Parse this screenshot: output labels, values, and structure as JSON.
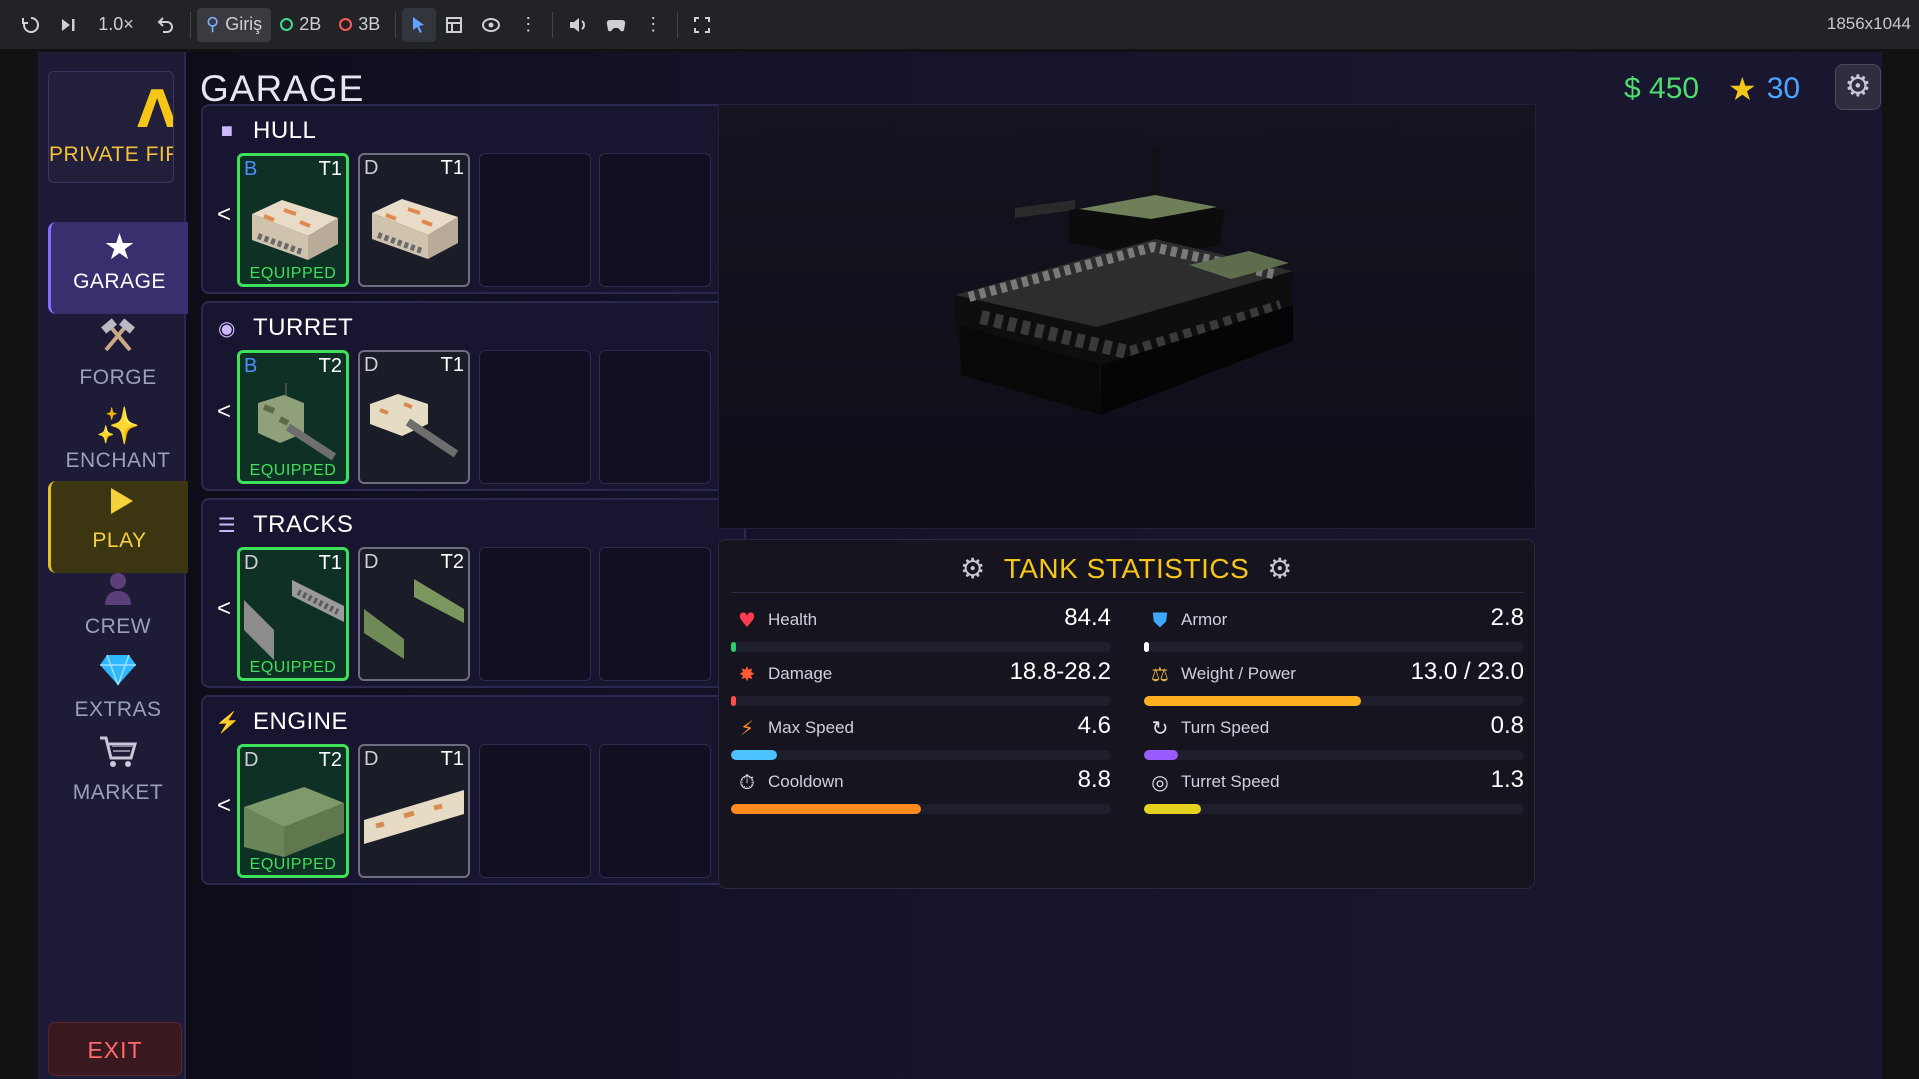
{
  "toolbar": {
    "speed": "1.0×",
    "scene_tab": "Giriş",
    "mode_2d": "2B",
    "mode_3d": "3B",
    "resolution": "1856x1044"
  },
  "header": {
    "title": "GARAGE",
    "money": "$ 450",
    "stars": "30"
  },
  "rank": {
    "logo": "Λ.",
    "name": "PRIVATE FIRST"
  },
  "nav": [
    {
      "label": "GARAGE",
      "icon": "star-icon"
    },
    {
      "label": "FORGE",
      "icon": "hammers-icon"
    },
    {
      "label": "ENCHANT",
      "icon": "sparkles-icon"
    },
    {
      "label": "PLAY",
      "icon": "play-icon"
    },
    {
      "label": "CREW",
      "icon": "person-icon"
    },
    {
      "label": "EXTRAS",
      "icon": "gem-icon"
    },
    {
      "label": "MARKET",
      "icon": "cart-icon"
    }
  ],
  "exit_label": "EXIT",
  "parts": [
    {
      "name": "HULL",
      "slots": [
        {
          "rarity": "B",
          "tier": "T1",
          "equipped": "EQUIPPED"
        },
        {
          "rarity": "D",
          "tier": "T1"
        }
      ]
    },
    {
      "name": "TURRET",
      "slots": [
        {
          "rarity": "B",
          "tier": "T2",
          "equipped": "EQUIPPED"
        },
        {
          "rarity": "D",
          "tier": "T1"
        }
      ]
    },
    {
      "name": "TRACKS",
      "slots": [
        {
          "rarity": "D",
          "tier": "T1",
          "equipped": "EQUIPPED"
        },
        {
          "rarity": "D",
          "tier": "T2"
        }
      ]
    },
    {
      "name": "ENGINE",
      "slots": [
        {
          "rarity": "D",
          "tier": "T2",
          "equipped": "EQUIPPED"
        },
        {
          "rarity": "D",
          "tier": "T1"
        }
      ]
    }
  ],
  "arrows": {
    "prev": "<",
    "next": ">"
  },
  "stats": {
    "title": "TANK STATISTICS",
    "items": [
      {
        "label": "Health",
        "value": "84.4",
        "fill": 0.01,
        "color": "#2ecc71"
      },
      {
        "label": "Armor",
        "value": "2.8",
        "fill": 0.005,
        "color": "#ffffff"
      },
      {
        "label": "Damage",
        "value": "18.8-28.2",
        "fill": 0.01,
        "color": "#ff4d4d"
      },
      {
        "label": "Weight / Power",
        "value": "13.0 / 23.0",
        "fill": 0.57,
        "color": "#ffb020"
      },
      {
        "label": "Max Speed",
        "value": "4.6",
        "fill": 0.12,
        "color": "#4cc3ff"
      },
      {
        "label": "Turn Speed",
        "value": "0.8",
        "fill": 0.09,
        "color": "#9b5cff"
      },
      {
        "label": "Cooldown",
        "value": "8.8",
        "fill": 0.5,
        "color": "#ff8a1f"
      },
      {
        "label": "Turret Speed",
        "value": "1.3",
        "fill": 0.15,
        "color": "#e6d21e"
      }
    ]
  }
}
